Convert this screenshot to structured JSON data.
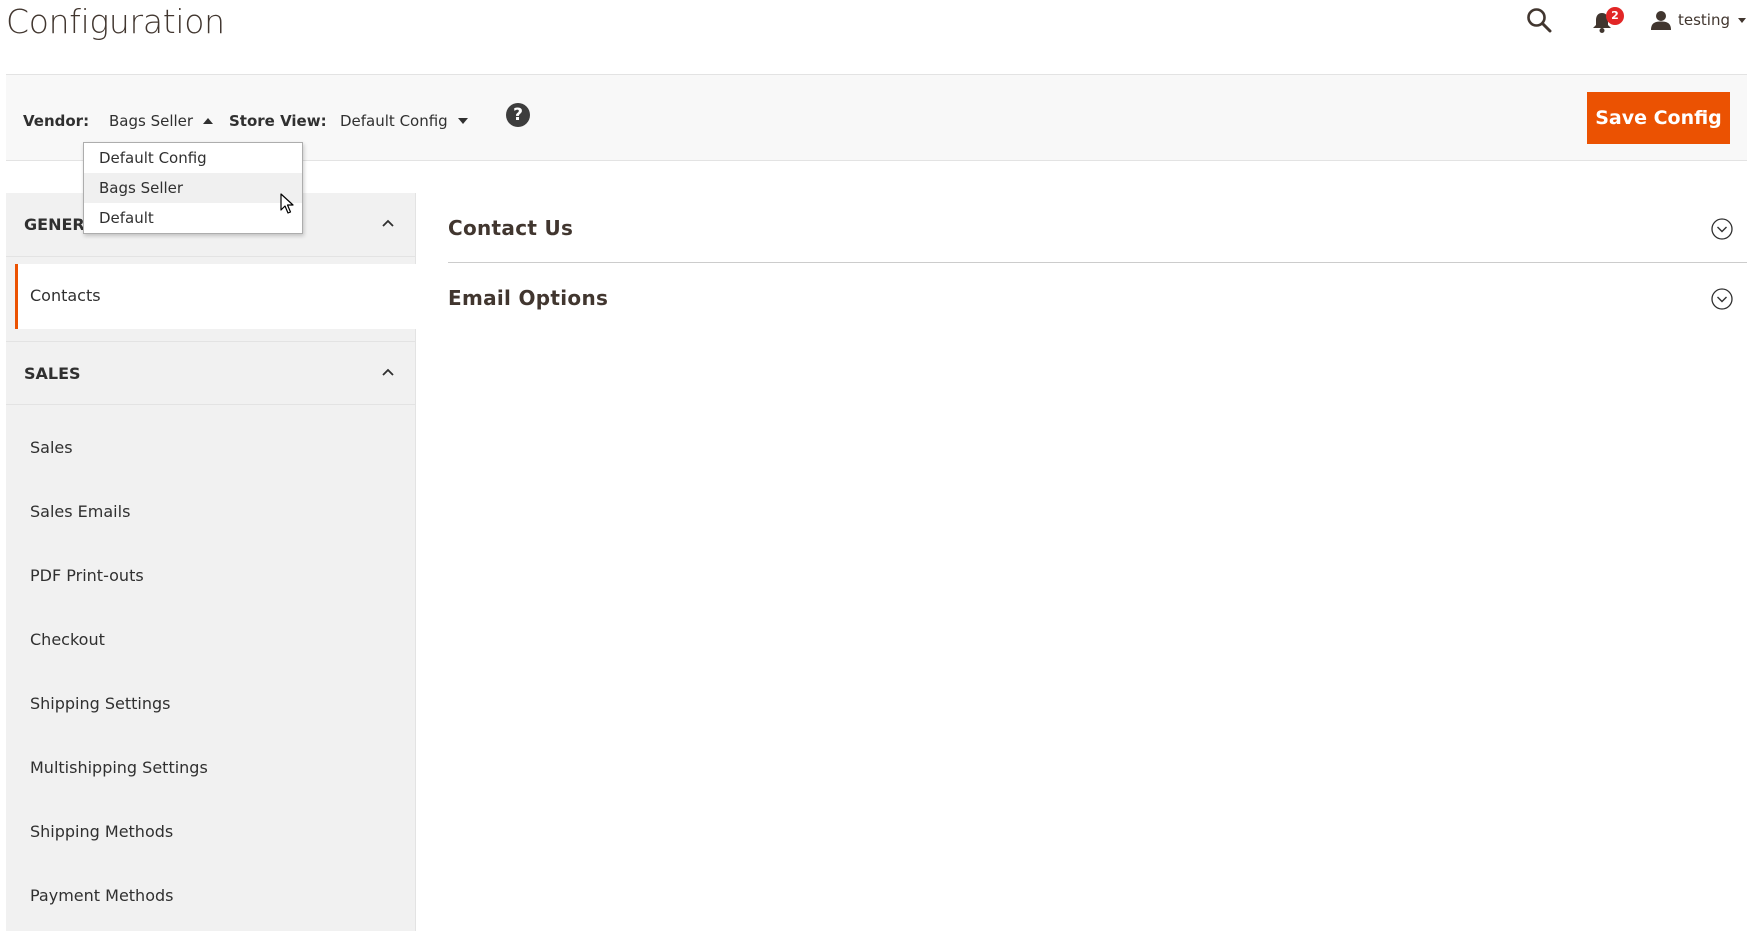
{
  "page": {
    "title": "Configuration"
  },
  "header": {
    "notifications_count": "2",
    "user_name": "testing",
    "icons": {
      "search": "search-icon",
      "notifications": "bell-icon",
      "user": "user-icon"
    }
  },
  "toolbar": {
    "vendor_label": "Vendor:",
    "vendor_value": "Bags Seller",
    "store_view_label": "Store View:",
    "store_view_value": "Default Config",
    "help_label": "?",
    "save_label": "Save Config",
    "save_color": "#eb5202"
  },
  "vendor_dropdown": {
    "options": [
      "Default Config",
      "Bags Seller",
      "Default"
    ],
    "hovered": "Bags Seller"
  },
  "sidebar": {
    "sections": [
      {
        "title": "GENERAL",
        "items": [
          "Contacts"
        ],
        "active": "Contacts"
      },
      {
        "title": "SALES",
        "items": [
          "Sales",
          "Sales Emails",
          "PDF Print-outs",
          "Checkout",
          "Shipping Settings",
          "Multishipping Settings",
          "Shipping Methods",
          "Payment Methods"
        ]
      }
    ]
  },
  "main": {
    "sections": [
      {
        "title": "Contact Us"
      },
      {
        "title": "Email Options"
      }
    ]
  }
}
